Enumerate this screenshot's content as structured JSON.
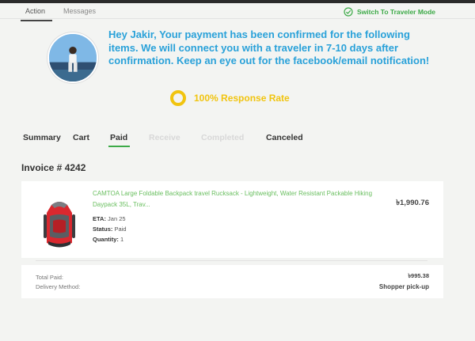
{
  "nav": {
    "tabs": [
      "Action",
      "Messages"
    ],
    "mode_switch_label": "Switch To Traveler Mode"
  },
  "message": "Hey Jakir, Your payment has been confirmed for the following items. We will connect you with a traveler in 7-10 days after confirmation. Keep an eye out for the facebook/email notification!",
  "response_rate": "100% Response Rate",
  "order_tabs": [
    {
      "label": "Summary",
      "state": "enabled"
    },
    {
      "label": "Cart",
      "state": "enabled"
    },
    {
      "label": "Paid",
      "state": "active"
    },
    {
      "label": "Receive",
      "state": "disabled"
    },
    {
      "label": "Completed",
      "state": "disabled"
    },
    {
      "label": "Canceled",
      "state": "enabled"
    }
  ],
  "invoice": {
    "title": "Invoice # 4242",
    "item": {
      "title": "CAMTOA Large Foldable Backpack travel Rucksack - Lightweight, Water Resistant Packable Hiking Daypack 35L,  Trav...",
      "price": "৳1,990.76",
      "eta_label": "ETA:",
      "eta_value": "Jan 25",
      "status_label": "Status:",
      "status_value": "Paid",
      "quantity_label": "Quantity:",
      "quantity_value": "1"
    }
  },
  "summary": {
    "total_paid_label": "Total Paid:",
    "total_paid_value": "৳995.38",
    "delivery_label": "Delivery Method:",
    "delivery_value": "Shopper pick-up"
  },
  "colors": {
    "accent_green": "#3daa48",
    "message_blue": "#29a1d9",
    "rate_yellow": "#f1c40f",
    "product_link": "#6abf60"
  },
  "icons": {
    "mode_switch": "check-circle-icon",
    "rate": "ring-icon"
  }
}
